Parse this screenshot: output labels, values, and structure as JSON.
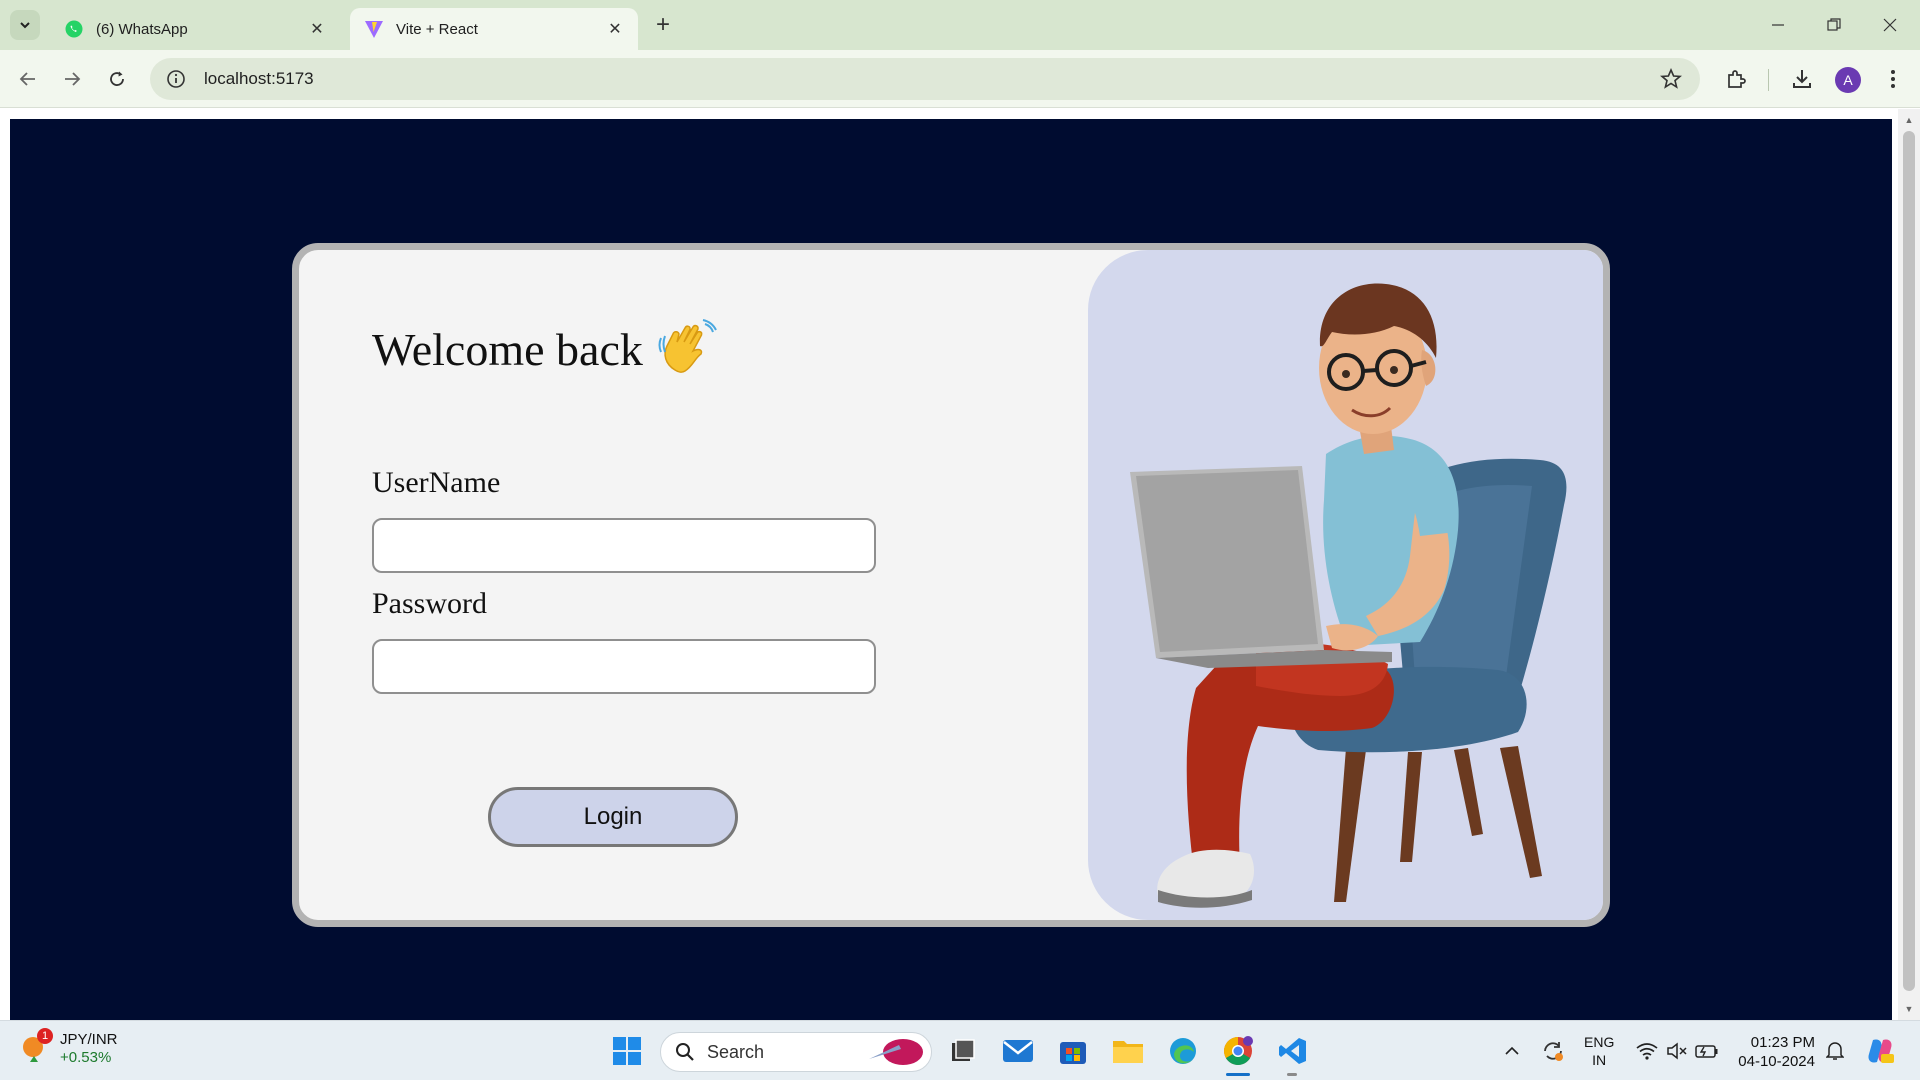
{
  "browser": {
    "tabs": [
      {
        "label": "(6) WhatsApp",
        "active": false,
        "icon": "whatsapp-icon"
      },
      {
        "label": "Vite + React",
        "active": true,
        "icon": "vite-icon"
      }
    ],
    "url": "localhost:5173",
    "profile_initial": "A"
  },
  "login": {
    "title": "Welcome back",
    "title_emoji": "👋",
    "username_label": "UserName",
    "username_value": "",
    "password_label": "Password",
    "password_value": "",
    "button_label": "Login"
  },
  "colors": {
    "page_bg": "#000c30",
    "card_bg": "#f4f4f4",
    "illustration_bg": "#d3d8ed",
    "button_bg": "#cdd3ea"
  },
  "taskbar": {
    "widget_symbol": "JPY/INR",
    "widget_change": "+0.53%",
    "widget_badge": "1",
    "search_label": "Search",
    "lang_line1": "ENG",
    "lang_line2": "IN",
    "time": "01:23 PM",
    "date": "04-10-2024"
  }
}
